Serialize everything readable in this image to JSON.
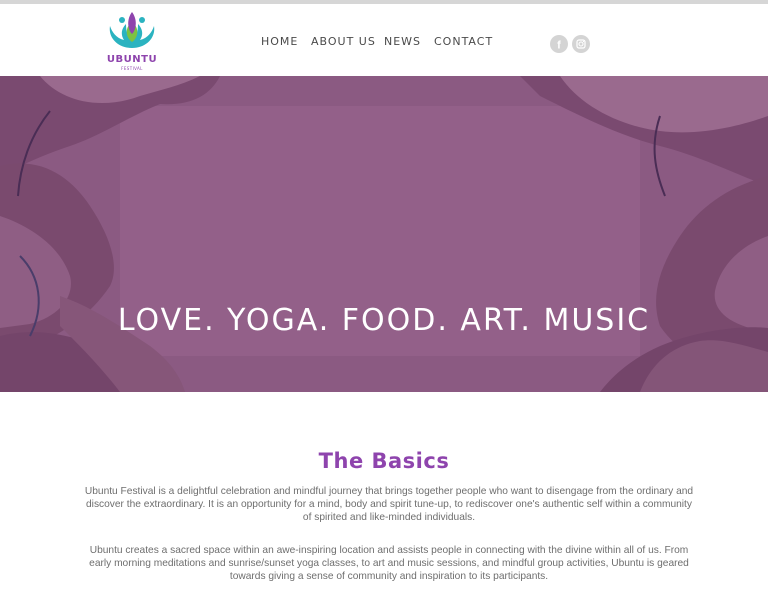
{
  "header": {
    "logo_text": "UBUNTU",
    "logo_subtext": "FESTIVAL"
  },
  "nav": {
    "items": [
      {
        "label": "HOME"
      },
      {
        "label": "ABOUT US"
      },
      {
        "label": "NEWS"
      },
      {
        "label": "CONTACT"
      }
    ]
  },
  "social": {
    "icons": [
      "facebook-icon",
      "instagram-icon"
    ],
    "facebook_glyph": "f"
  },
  "hero": {
    "title": "LOVE. YOGA. FOOD. ART. MUSIC"
  },
  "basics": {
    "title": "The Basics",
    "paragraphs": [
      "Ubuntu Festival is a delightful celebration and mindful journey that brings together people who want to disengage from the ordinary and discover the extraordinary. It is an opportunity for a mind, body and spirit tune-up, to rediscover one's authentic self within a community of spirited and like-minded individuals.",
      "Ubuntu creates a sacred space within an awe-inspiring location and assists people in connecting with the divine within all of us. From early morning meditations and sunrise/sunset yoga classes, to art and music sessions, and mindful group activities, Ubuntu is geared towards giving a sense of community and inspiration to its participants."
    ]
  },
  "colors": {
    "brand_purple": "#8e44ad",
    "logo_teal": "#2bb3c0",
    "hero_overlay": "#8b5a82",
    "nav_text": "#4a4a4a",
    "body_text": "#6e6e6e",
    "social_bg": "#d4d4d4"
  }
}
